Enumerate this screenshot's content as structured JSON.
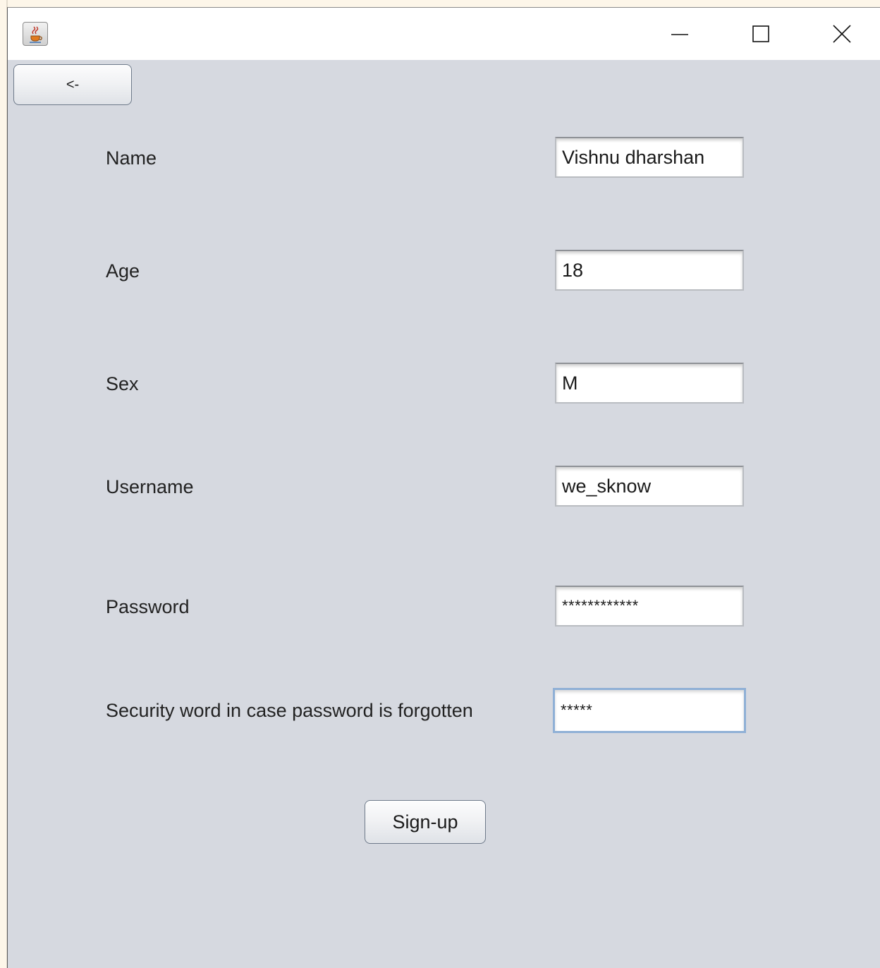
{
  "window": {
    "title": "",
    "controls": {
      "minimize": "minimize",
      "maximize": "maximize",
      "close": "close"
    }
  },
  "back_button": {
    "label": "<-"
  },
  "form": {
    "fields": [
      {
        "label": "Name",
        "value": "Vishnu dharshan",
        "type": "text"
      },
      {
        "label": "Age",
        "value": "18",
        "type": "text"
      },
      {
        "label": "Sex",
        "value": "M",
        "type": "text"
      },
      {
        "label": "Username",
        "value": "we_sknow",
        "type": "text"
      },
      {
        "label": "Password",
        "value": "************",
        "type": "password"
      },
      {
        "label": "Security word in case password is forgotten",
        "value": "*****",
        "type": "password",
        "focused": true
      }
    ],
    "submit_label": "Sign-up"
  },
  "icons": {
    "app": "java-cup-icon",
    "minimize": "minimize-icon",
    "maximize": "maximize-icon",
    "close": "close-icon"
  },
  "colors": {
    "panel_background": "#d6d9e0",
    "titlebar_background": "#ffffff",
    "focus_border": "#8fb0d6"
  }
}
